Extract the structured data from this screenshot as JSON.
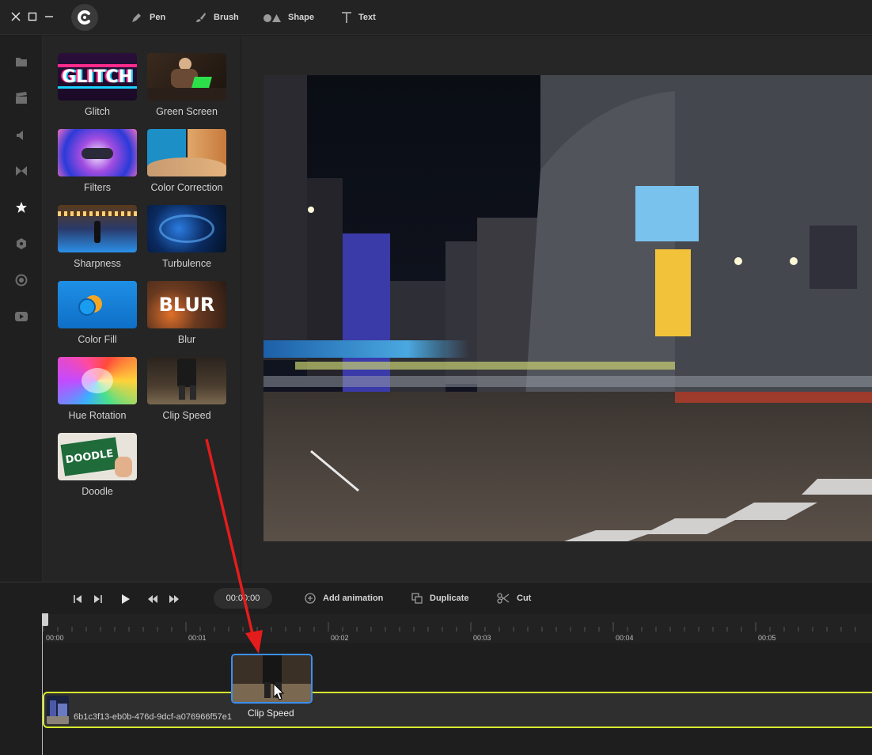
{
  "toolbar": {
    "tools": [
      {
        "label": "Pen",
        "icon": "pen-icon"
      },
      {
        "label": "Brush",
        "icon": "brush-icon"
      },
      {
        "label": "Shape",
        "icon": "shape-icon"
      },
      {
        "label": "Text",
        "icon": "text-icon"
      }
    ]
  },
  "sidebar": {
    "items": [
      {
        "icon": "folder-icon"
      },
      {
        "icon": "clapper-icon"
      },
      {
        "icon": "audio-icon"
      },
      {
        "icon": "transition-icon"
      },
      {
        "icon": "star-icon",
        "active": true
      },
      {
        "icon": "hexagon-icon"
      },
      {
        "icon": "record-icon"
      },
      {
        "icon": "youtube-icon"
      }
    ]
  },
  "effects": [
    {
      "label": "Glitch",
      "thumb_text": "GLITCH"
    },
    {
      "label": "Green Screen"
    },
    {
      "label": "Filters"
    },
    {
      "label": "Color Correction"
    },
    {
      "label": "Sharpness"
    },
    {
      "label": "Turbulence"
    },
    {
      "label": "Color Fill"
    },
    {
      "label": "Blur",
      "thumb_text": "BLUR"
    },
    {
      "label": "Hue Rotation"
    },
    {
      "label": "Clip Speed"
    },
    {
      "label": "Doodle",
      "thumb_text": "DOODLE"
    }
  ],
  "timeline": {
    "timecode": "00:00:00",
    "buttons": {
      "add_animation": "Add animation",
      "duplicate": "Duplicate",
      "cut": "Cut"
    },
    "ruler": [
      "00:00",
      "00:01",
      "00:02",
      "00:03",
      "00:04",
      "00:05"
    ],
    "track_label": "6b1c3f13-eb0b-476d-9dcf-a076966f57e1",
    "dragged_clip_label": "Clip Speed"
  },
  "colors": {
    "track_border": "#d7ec2e",
    "drag_border": "#3d8ff0",
    "arrow": "#e51c1c"
  }
}
